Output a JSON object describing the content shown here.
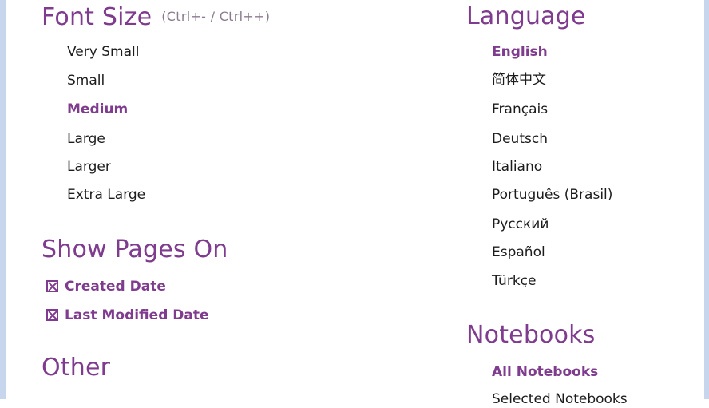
{
  "font_size": {
    "title": "Font Size",
    "shortcut": "(Ctrl+- / Ctrl++)",
    "options": [
      "Very Small",
      "Small",
      "Medium",
      "Large",
      "Larger",
      "Extra Large"
    ],
    "selected": "Medium"
  },
  "show_pages_on": {
    "title": "Show Pages On",
    "options": [
      {
        "label": "Created Date",
        "checked": true
      },
      {
        "label": "Last Modified Date",
        "checked": true
      }
    ]
  },
  "other": {
    "title": "Other"
  },
  "language": {
    "title": "Language",
    "options": [
      "English",
      "简体中文",
      "Français",
      "Deutsch",
      "Italiano",
      "Português (Brasil)",
      "Русский",
      "Español",
      "Türkçe"
    ],
    "selected": "English"
  },
  "notebooks": {
    "title": "Notebooks",
    "options": [
      "All Notebooks",
      "Selected Notebooks"
    ],
    "selected": "All Notebooks"
  },
  "colors": {
    "accent": "#7f3b8e",
    "frame": "#c7d6ec"
  }
}
